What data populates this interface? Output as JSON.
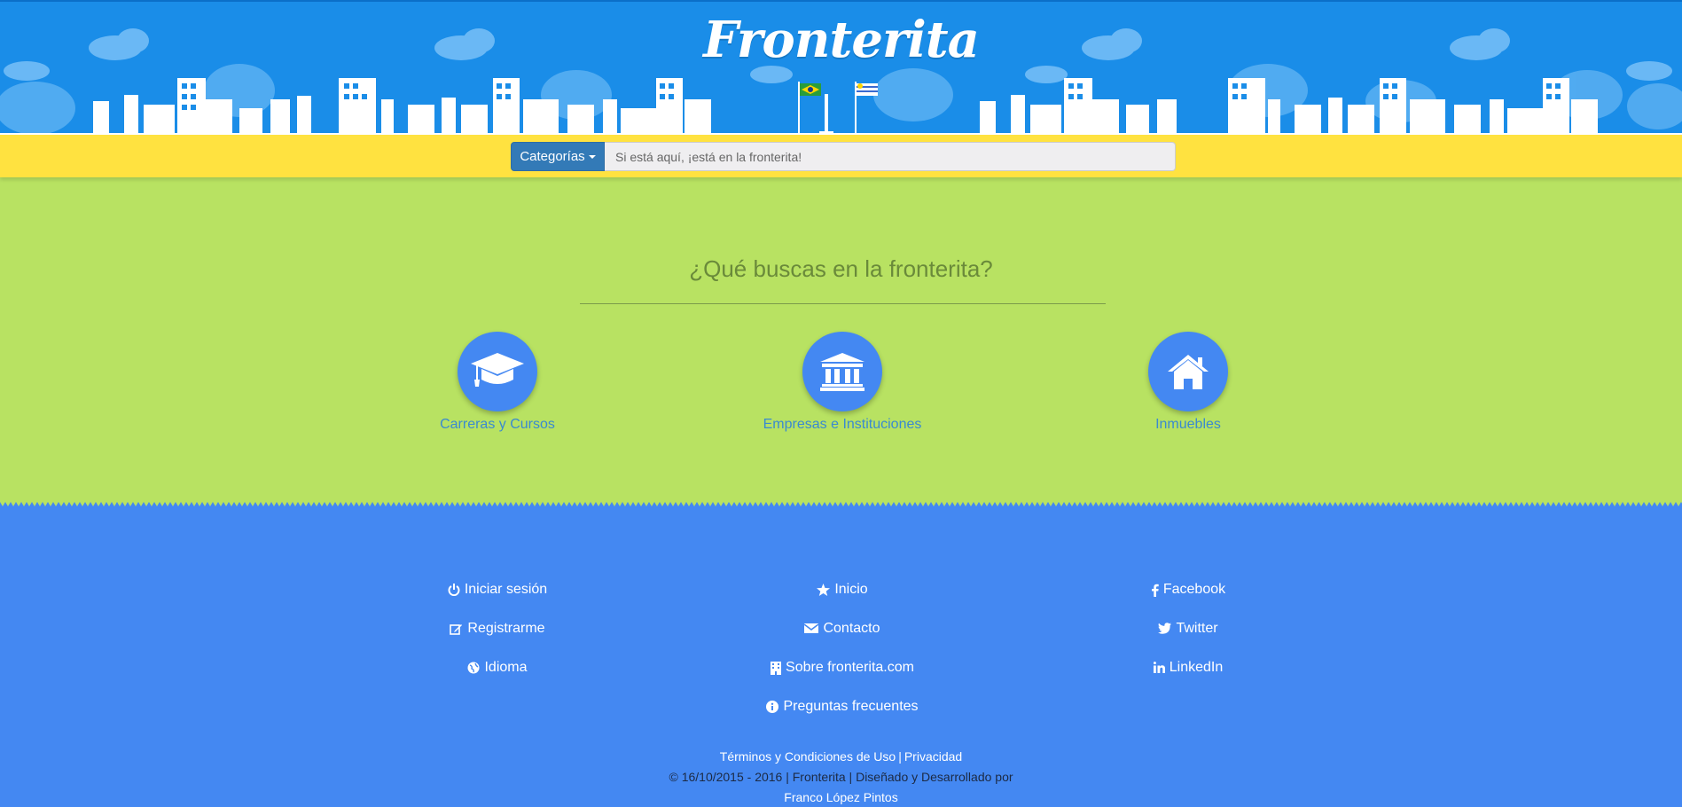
{
  "header": {
    "logo_text": "Fronterita"
  },
  "search": {
    "category_button_label": "Categorías",
    "placeholder": "Si está aquí, ¡está en la fronterita!"
  },
  "main": {
    "title": "¿Qué buscas en la fronterita?",
    "categories": [
      {
        "label": "Carreras y Cursos",
        "icon": "graduation-cap-icon"
      },
      {
        "label": "Empresas e Instituciones",
        "icon": "institution-icon"
      },
      {
        "label": "Inmuebles",
        "icon": "home-icon"
      }
    ]
  },
  "footer": {
    "col1": [
      {
        "label": "Iniciar sesión",
        "icon": "power-icon"
      },
      {
        "label": "Registrarme",
        "icon": "edit-icon"
      },
      {
        "label": "Idioma",
        "icon": "globe-icon"
      }
    ],
    "col2": [
      {
        "label": "Inicio",
        "icon": "star-icon"
      },
      {
        "label": "Contacto",
        "icon": "envelope-icon"
      },
      {
        "label": "Sobre fronterita.com",
        "icon": "building-icon"
      },
      {
        "label": "Preguntas frecuentes",
        "icon": "info-icon"
      }
    ],
    "col3": [
      {
        "label": "Facebook",
        "icon": "facebook-icon"
      },
      {
        "label": "Twitter",
        "icon": "twitter-icon"
      },
      {
        "label": "LinkedIn",
        "icon": "linkedin-icon"
      }
    ],
    "terms_label": "Términos y Condiciones de Uso",
    "separator": "|",
    "privacy_label": "Privacidad",
    "copyright": "© 16/10/2015 - 2016 | Fronterita | Diseñado y Desarrollado por",
    "author": "Franco López Pintos"
  },
  "colors": {
    "header_blue": "#1a8de8",
    "search_yellow": "#ffe240",
    "main_green": "#b8e262",
    "footer_blue": "#4488f2",
    "category_button": "#337ab7"
  }
}
